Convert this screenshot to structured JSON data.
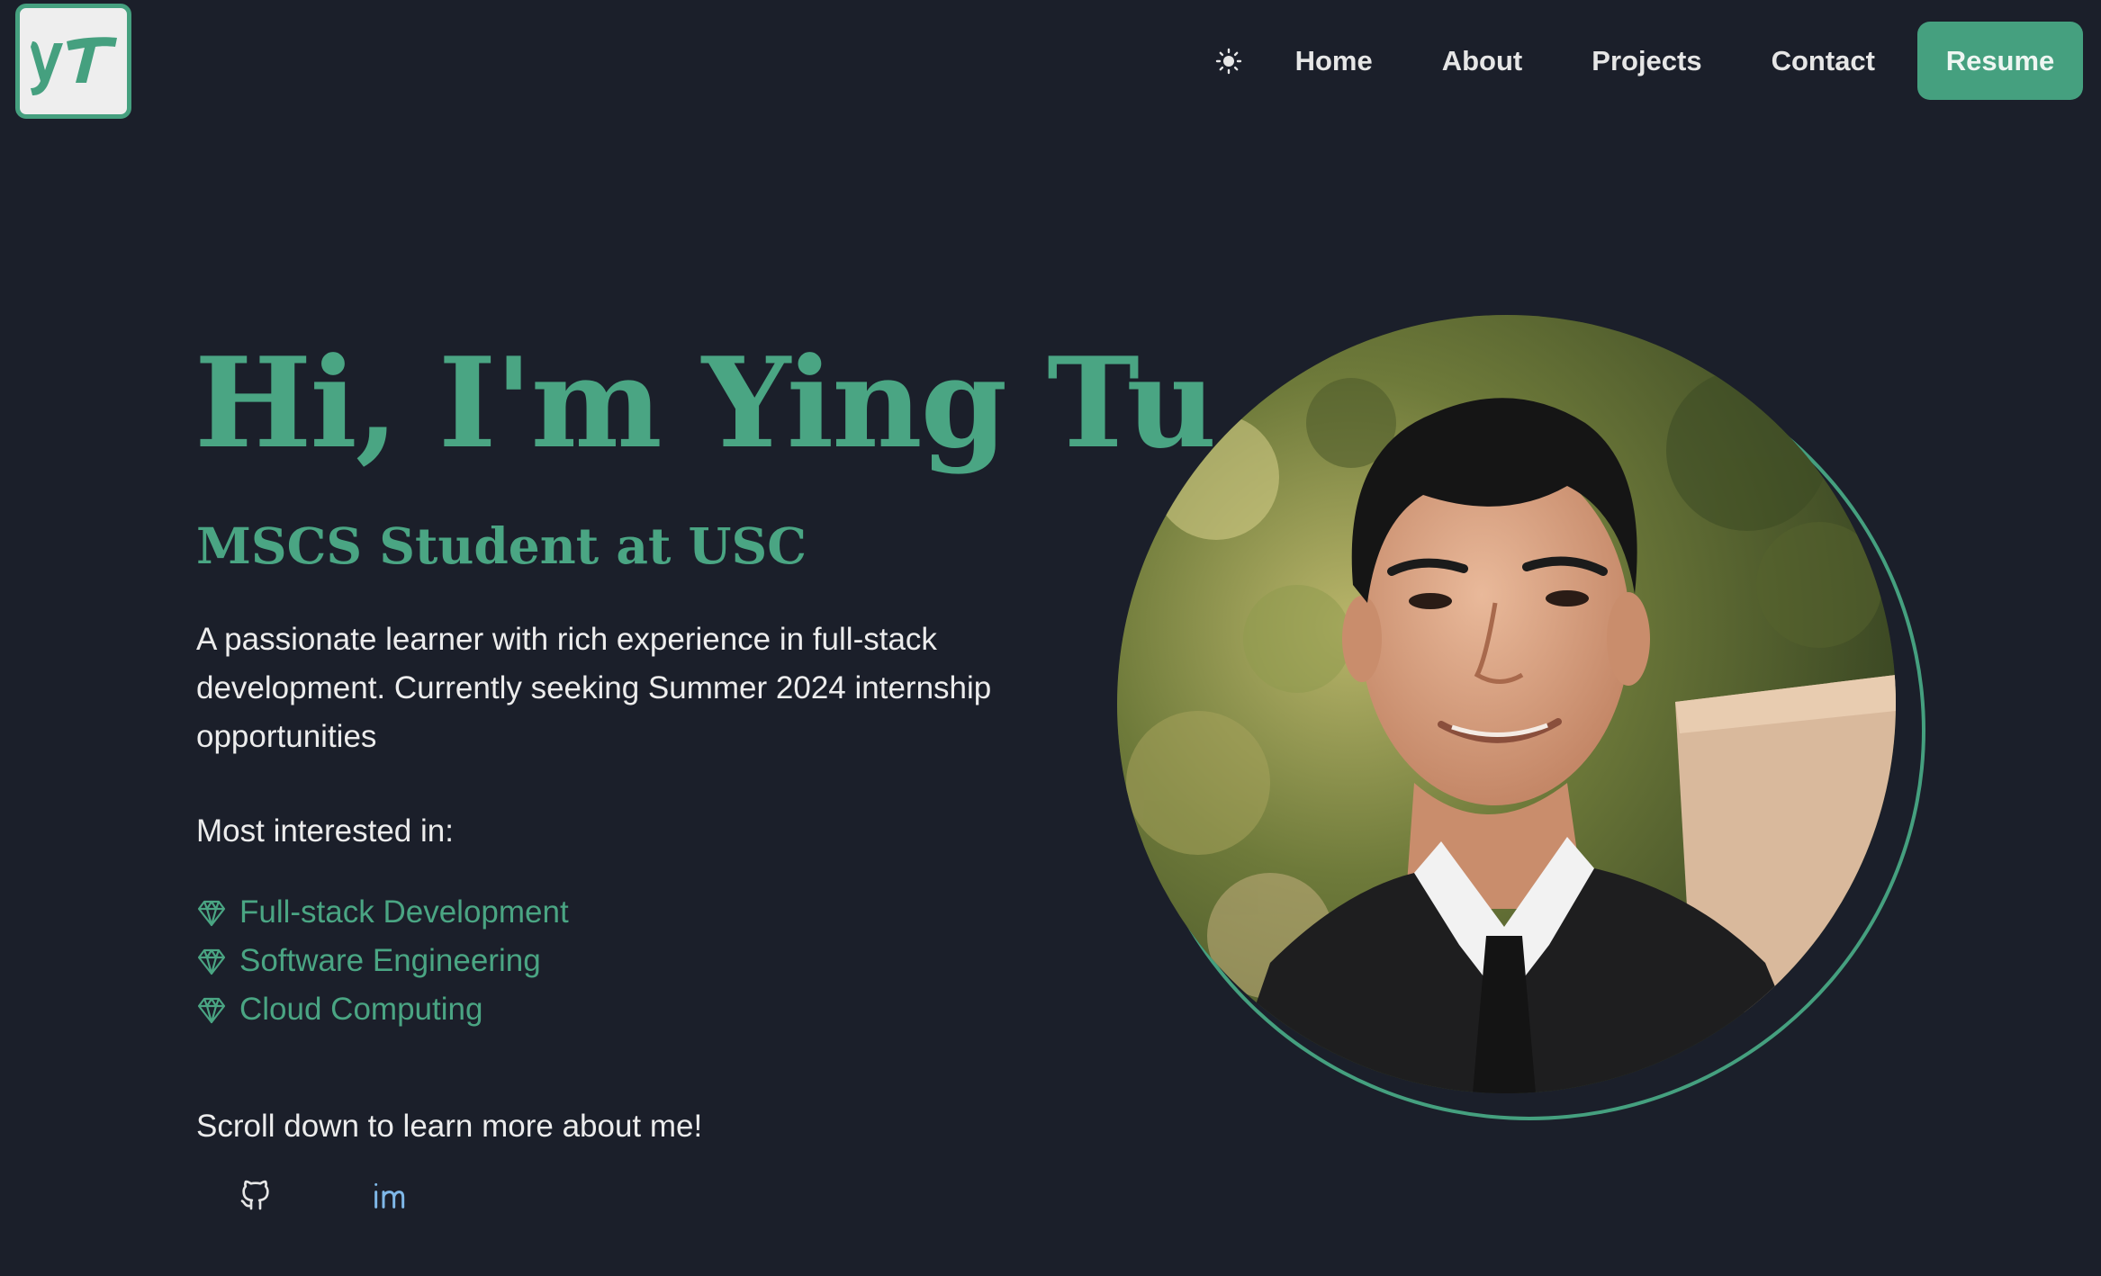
{
  "header": {
    "logo_icon": "yt-logo",
    "theme_toggle_icon": "sun-icon",
    "nav": [
      {
        "label": "Home"
      },
      {
        "label": "About"
      },
      {
        "label": "Projects"
      },
      {
        "label": "Contact"
      }
    ],
    "resume_label": "Resume"
  },
  "hero": {
    "title": "Hi, I'm Ying Tu",
    "subtitle": "MSCS Student at USC",
    "description": "A passionate learner with rich experience in full-stack development. Currently seeking Summer 2024 internship opportunities",
    "interests_heading": "Most interested in:",
    "interests": [
      {
        "icon": "gem-icon",
        "label": "Full-stack Development"
      },
      {
        "icon": "gem-icon",
        "label": "Software Engineering"
      },
      {
        "icon": "gem-icon",
        "label": "Cloud Computing"
      }
    ],
    "scroll_note": "Scroll down to learn more about me!",
    "social": [
      {
        "icon": "github-icon"
      },
      {
        "icon": "linkedin-icon"
      }
    ]
  },
  "portrait": {
    "subject": "profile-photo"
  },
  "colors": {
    "background": "#1b1f2a",
    "accent": "#45a07f",
    "text": "#ececec"
  }
}
